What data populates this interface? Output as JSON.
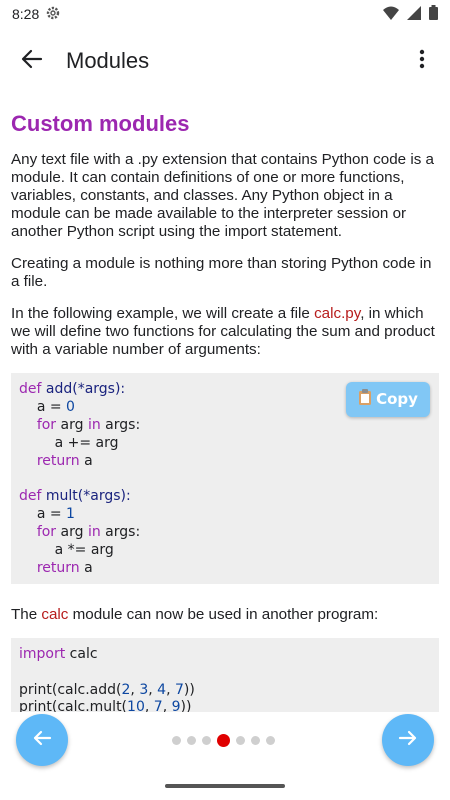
{
  "status_bar": {
    "time": "8:28"
  },
  "app_bar": {
    "title": "Modules"
  },
  "content": {
    "section_title": "Custom modules",
    "paragraph1": "Any text file with a .py extension that contains Python code is a module. It can contain definitions of one or more functions, variables, constants, and classes. Any Python object in a module can be made available to the interpreter session or another Python script using the import statement.",
    "paragraph2": "Creating a module is nothing more than storing Python code in a file.",
    "paragraph3": {
      "before": "In the following example, we will create a file ",
      "filename": "calc.py",
      "after": ", in which we will define two functions for calculating the sum and product with a variable number of arguments:"
    },
    "copy_button_label": "Copy",
    "code1": {
      "def1_kw": "def",
      "def1_name": "add(*args):",
      "l2": "a = ",
      "l2_num": "0",
      "l3_kw": "for",
      "l3_a": " arg ",
      "l3_in": "in",
      "l3_b": " args:",
      "l4": "a += arg",
      "l5_kw": "return",
      "l5_b": " a",
      "def2_kw": "def",
      "def2_name": "mult(*args):",
      "l8": "a = ",
      "l8_num": "1",
      "l9_kw": "for",
      "l9_a": " arg ",
      "l9_in": "in",
      "l9_b": " args:",
      "l10": "a *= arg",
      "l11_kw": "return",
      "l11_b": " a"
    },
    "paragraph4": {
      "before": "The ",
      "module": "calc",
      "after": " module can now be used in another program:"
    },
    "code2": {
      "l1_kw": "import",
      "l1_b": " calc",
      "l3_a": "print(calc.add(",
      "l3_n1": "2",
      "l3_c1": ", ",
      "l3_n2": "3",
      "l3_c2": ", ",
      "l3_n3": "4",
      "l3_c3": ", ",
      "l3_n4": "7",
      "l3_end": "))",
      "l4_a": "print(calc.mult(",
      "l4_n1": "10",
      "l4_c1": ", ",
      "l4_n2": "7",
      "l4_c2": ", ",
      "l4_n3": "9",
      "l4_end": "))"
    }
  },
  "pager": {
    "total": 7,
    "current_index": 3
  },
  "colors": {
    "accent": "#9c27b0",
    "nav_button": "#5eb8f7",
    "active_dot": "#e00000",
    "copy_button": "#81c7f5"
  }
}
